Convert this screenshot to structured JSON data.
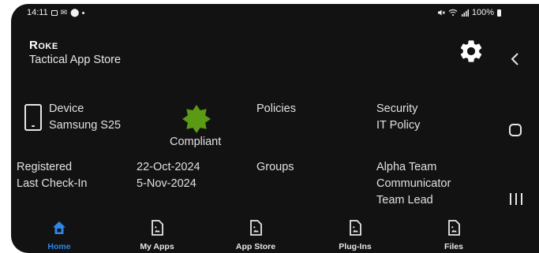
{
  "status_bar": {
    "time": "14:11",
    "battery": "100%"
  },
  "header": {
    "brand": "Roke",
    "subtitle": "Tactical App Store"
  },
  "device": {
    "label": "Device",
    "model": "Samsung S25",
    "status": "Compliant"
  },
  "policies": {
    "label": "Policies",
    "items": [
      "Security",
      "IT Policy"
    ]
  },
  "registration": {
    "registered_label": "Registered",
    "registered_value": "22-Oct-2024",
    "last_checkin_label": "Last Check-In",
    "last_checkin_value": "5-Nov-2024"
  },
  "groups": {
    "label": "Groups",
    "items": [
      "Alpha Team",
      "Communicator",
      "Team Lead"
    ]
  },
  "bottom_nav": {
    "tabs": [
      {
        "label": "Home",
        "icon": "home-icon",
        "active": true
      },
      {
        "label": "My Apps",
        "icon": "image-file-icon",
        "active": false
      },
      {
        "label": "App Store",
        "icon": "image-file-icon",
        "active": false
      },
      {
        "label": "Plug-Ins",
        "icon": "image-file-icon",
        "active": false
      },
      {
        "label": "Files",
        "icon": "image-file-icon",
        "active": false
      }
    ]
  },
  "colors": {
    "background": "#121212",
    "accent": "#2f86e8",
    "compliant": "#5a9a14",
    "text": "#e0e0e0"
  }
}
